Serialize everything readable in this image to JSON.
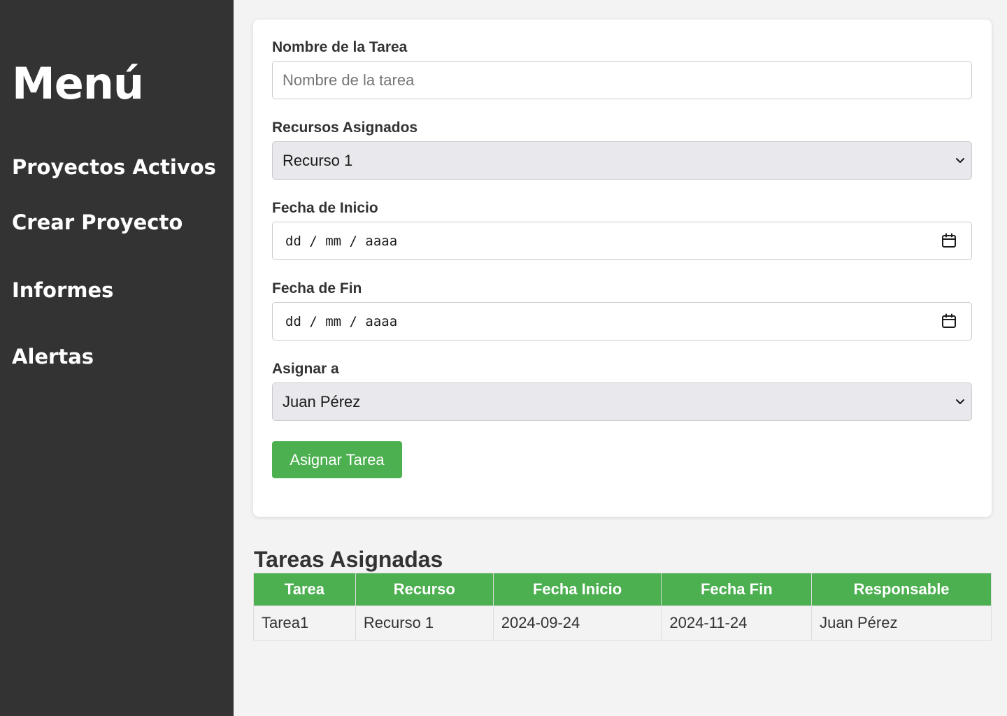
{
  "sidebar": {
    "title": "Menú",
    "items": [
      {
        "label": "Proyectos Activos"
      },
      {
        "label": "Crear Proyecto"
      },
      {
        "label": "Informes"
      },
      {
        "label": "Alertas"
      }
    ]
  },
  "form": {
    "task_name": {
      "label": "Nombre de la Tarea",
      "value": "",
      "placeholder": "Nombre de la tarea"
    },
    "resources": {
      "label": "Recursos Asignados",
      "selected": "Recurso 1"
    },
    "start_date": {
      "label": "Fecha de Inicio",
      "value": "dd / mm / aaaa"
    },
    "end_date": {
      "label": "Fecha de Fin",
      "value": "dd / mm / aaaa"
    },
    "assignee": {
      "label": "Asignar a",
      "selected": "Juan Pérez"
    },
    "submit_label": "Asignar Tarea"
  },
  "tasks": {
    "title": "Tareas Asignadas",
    "headers": [
      "Tarea",
      "Recurso",
      "Fecha Inicio",
      "Fecha Fin",
      "Responsable"
    ],
    "rows": [
      [
        "Tarea1",
        "Recurso 1",
        "2024-09-24",
        "2024-11-24",
        "Juan Pérez"
      ]
    ]
  },
  "colors": {
    "sidebar_bg": "#333333",
    "accent_green": "#4caf50",
    "page_bg": "#f3f3f3"
  },
  "icons": {
    "select_arrow": "chevron-down-icon",
    "date_picker": "calendar-icon"
  }
}
